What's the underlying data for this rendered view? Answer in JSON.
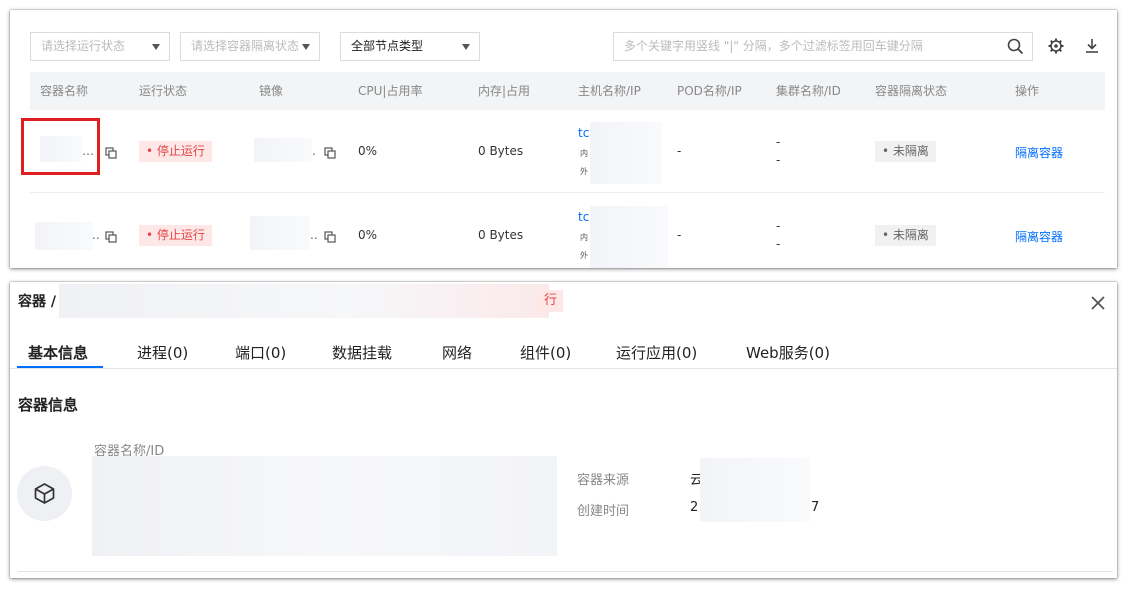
{
  "filters": {
    "run_status_placeholder": "请选择运行状态",
    "isolation_status_placeholder": "请选择容器隔离状态",
    "node_type_value": "全部节点类型",
    "search_placeholder": "多个关键字用竖线 \"|\" 分隔，多个过滤标签用回车键分隔"
  },
  "icons": {
    "search": "search-icon",
    "settings": "gear-icon",
    "download": "download-icon",
    "copy": "copy-icon",
    "close": "close-icon",
    "container": "cube-icon"
  },
  "table": {
    "columns": [
      "容器名称",
      "运行状态",
      "镜像",
      "CPU|占用率",
      "内存|占用",
      "主机名称/IP",
      "POD名称/IP",
      "集群名称/ID",
      "容器隔离状态",
      "操作"
    ],
    "rows": [
      {
        "name_suffix": "…",
        "status": "停止运行",
        "image_suffix": ".",
        "cpu": "0%",
        "memory": "0 Bytes",
        "host_prefix": "tc",
        "host_inner": "内",
        "host_outer": "外",
        "pod": "-",
        "cluster_line1": "-",
        "cluster_line2": "-",
        "isolation": "未隔离",
        "action": "隔离容器"
      },
      {
        "name_suffix": "..",
        "status": "停止运行",
        "image_suffix": "..",
        "cpu": "0%",
        "memory": "0 Bytes",
        "host_prefix": "tc",
        "host_inner": "内",
        "host_outer": "外",
        "pod": "-",
        "cluster_line1": "-",
        "cluster_line2": "-",
        "isolation": "未隔离",
        "action": "隔离容器"
      }
    ]
  },
  "detail": {
    "breadcrumb": "容器 /",
    "status_fragment": "行",
    "tabs": [
      "基本信息",
      "进程(0)",
      "端口(0)",
      "数据挂载",
      "网络",
      "组件(0)",
      "运行应用(0)",
      "Web服务(0)"
    ],
    "section_title": "容器信息",
    "name_id_label": "容器名称/ID",
    "source_label": "容器来源",
    "source_value_prefix": "云",
    "created_label": "创建时间",
    "created_value_prefix": "2",
    "created_value_suffix": "7"
  },
  "colors": {
    "accent": "#006eff",
    "danger": "#e54545",
    "danger_bg": "#fde7e7",
    "highlight": "#e02020"
  }
}
